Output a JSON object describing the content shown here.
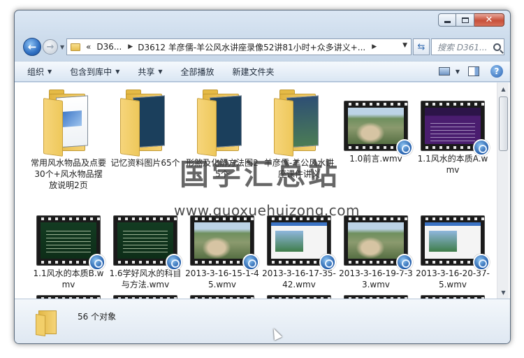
{
  "window": {
    "controls": {
      "minimize": "minimize",
      "maximize": "maximize",
      "close": "close"
    }
  },
  "nav": {
    "back_icon": "back-arrow-icon",
    "forward_icon": "forward-arrow-icon",
    "breadcrumb": [
      "«",
      "D36...",
      "D3612 羊彦儒-羊公风水讲座录像52讲81小时+众多讲义+..."
    ],
    "search_placeholder": "搜索 D361..."
  },
  "toolbar": {
    "organize": "组织",
    "include_in_library": "包含到库中",
    "share": "共享",
    "play_all": "全部播放",
    "new_folder": "新建文件夹"
  },
  "items": [
    {
      "type": "folder",
      "variant": "doc",
      "label": "常用风水物品及点要30个+风水物品摆放说明2页"
    },
    {
      "type": "folder",
      "variant": "dark",
      "label": "记忆资料图片65个"
    },
    {
      "type": "folder",
      "variant": "dark",
      "label": "形煞及化解方法图25个"
    },
    {
      "type": "folder",
      "variant": "pic",
      "label": "羊彦儒-羊公风水讲座课件讲义"
    },
    {
      "type": "video",
      "frame": "aerial",
      "label": "1.0前言.wmv"
    },
    {
      "type": "video",
      "frame": "slide-purple",
      "label": "1.1风水的本质A.wmv"
    },
    {
      "type": "video",
      "frame": "slide-green",
      "label": "1.1风水的本质B.wmv"
    },
    {
      "type": "video",
      "frame": "slide-green",
      "label": "1.6学好风水的科目与方法.wmv"
    },
    {
      "type": "video",
      "frame": "aerial",
      "label": "2013-3-16-15-1-45.wmv"
    },
    {
      "type": "video",
      "frame": "screen",
      "label": "2013-3-16-17-35-42.wmv"
    },
    {
      "type": "video",
      "frame": "aerial",
      "label": "2013-3-16-19-7-33.wmv"
    },
    {
      "type": "video",
      "frame": "screen",
      "label": "2013-3-16-20-37-5.wmv"
    },
    {
      "type": "video",
      "frame": "slide-purple",
      "label": ""
    },
    {
      "type": "video",
      "frame": "screen",
      "label": ""
    },
    {
      "type": "video",
      "frame": "screen",
      "label": ""
    },
    {
      "type": "video",
      "frame": "screen",
      "label": ""
    },
    {
      "type": "video",
      "frame": "aerial",
      "label": ""
    },
    {
      "type": "video",
      "frame": "aerial",
      "label": ""
    }
  ],
  "watermark": {
    "cn": "国学汇总站",
    "en": "www.guoxuehuizong.com"
  },
  "details": {
    "count": "56 个对象"
  }
}
